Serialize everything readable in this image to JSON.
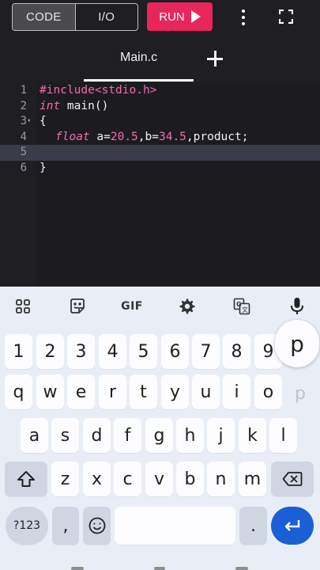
{
  "toolbar": {
    "code_label": "CODE",
    "io_label": "I/O",
    "run_label": "RUN",
    "more_icon": "more-vert-icon",
    "fullscreen_icon": "fullscreen-icon"
  },
  "tabs": {
    "file_name": "Main.c",
    "add_icon": "plus-icon"
  },
  "editor": {
    "lines": [
      {
        "num": "1",
        "text": "#include<stdio.h>"
      },
      {
        "num": "2",
        "text": "int main()"
      },
      {
        "num": "3",
        "text": "{"
      },
      {
        "num": "4",
        "text": "float a=20.5,b=34.5,product;"
      },
      {
        "num": "5",
        "text": ""
      },
      {
        "num": "6",
        "text": "}"
      }
    ],
    "highlight_line": 5
  },
  "keyboard": {
    "tools": [
      "apps-icon",
      "sticker-icon",
      "GIF",
      "settings-icon",
      "translate-icon",
      "mic-icon"
    ],
    "row_numbers": [
      "1",
      "2",
      "3",
      "4",
      "5",
      "6",
      "7",
      "8",
      "9"
    ],
    "popup_key": "p",
    "row1": [
      "q",
      "w",
      "e",
      "r",
      "t",
      "y",
      "u",
      "i",
      "o"
    ],
    "row1_ghost": "p",
    "row2": [
      "a",
      "s",
      "d",
      "f",
      "g",
      "h",
      "j",
      "k",
      "l"
    ],
    "row3": [
      "z",
      "x",
      "c",
      "v",
      "b",
      "n",
      "m"
    ],
    "symbols_label": "?123",
    "comma_label": ",",
    "period_label": ".",
    "emoji_icon": "emoji-icon",
    "shift_icon": "shift-icon",
    "backspace_icon": "backspace-icon",
    "enter_icon": "enter-icon"
  },
  "colors": {
    "run": "#e8265b",
    "keyword": "#ee6bb0",
    "enter": "#1a5fd6"
  }
}
